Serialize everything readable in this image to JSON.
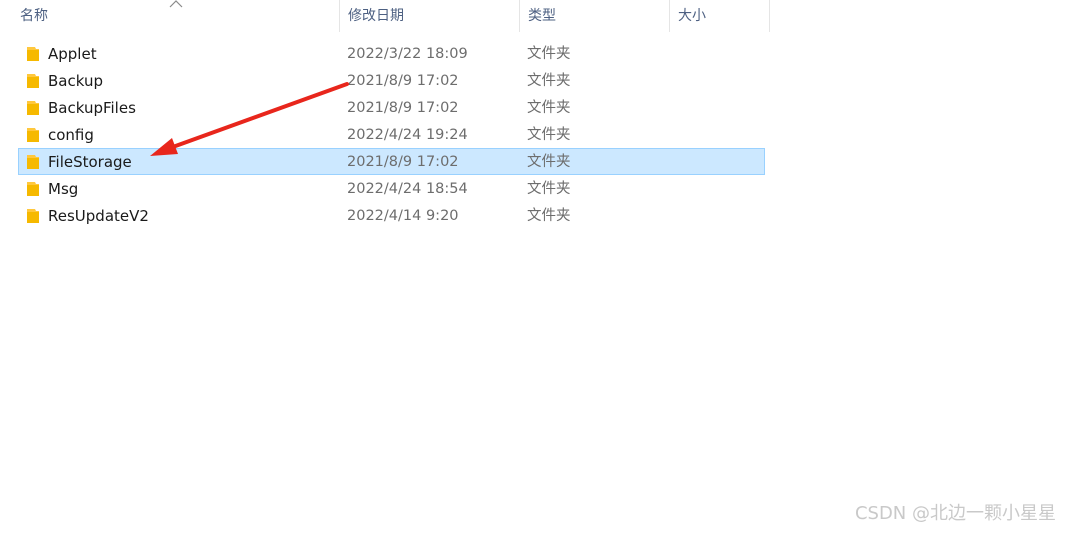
{
  "columns": {
    "name": "名称",
    "date": "修改日期",
    "type": "类型",
    "size": "大小"
  },
  "sort": {
    "column": "name",
    "direction": "ascending",
    "icon": "sort-up-icon"
  },
  "rows": [
    {
      "name": "Applet",
      "date": "2022/3/22 18:09",
      "type": "文件夹",
      "selected": false,
      "icon": "folder-icon"
    },
    {
      "name": "Backup",
      "date": "2021/8/9 17:02",
      "type": "文件夹",
      "selected": false,
      "icon": "folder-icon"
    },
    {
      "name": "BackupFiles",
      "date": "2021/8/9 17:02",
      "type": "文件夹",
      "selected": false,
      "icon": "folder-icon"
    },
    {
      "name": "config",
      "date": "2022/4/24 19:24",
      "type": "文件夹",
      "selected": false,
      "icon": "folder-icon"
    },
    {
      "name": "FileStorage",
      "date": "2021/8/9 17:02",
      "type": "文件夹",
      "selected": true,
      "icon": "folder-icon"
    },
    {
      "name": "Msg",
      "date": "2022/4/24 18:54",
      "type": "文件夹",
      "selected": false,
      "icon": "folder-icon"
    },
    {
      "name": "ResUpdateV2",
      "date": "2022/4/14 9:20",
      "type": "文件夹",
      "selected": false,
      "icon": "folder-icon"
    }
  ],
  "colors": {
    "selection_bg": "#cce8ff",
    "selection_border": "#99d1ff",
    "header_text": "#4d6082",
    "folder_yellow": "#ffc83d",
    "annotation_red": "#e8261c"
  },
  "watermark": "CSDN @北边一颗小星星"
}
